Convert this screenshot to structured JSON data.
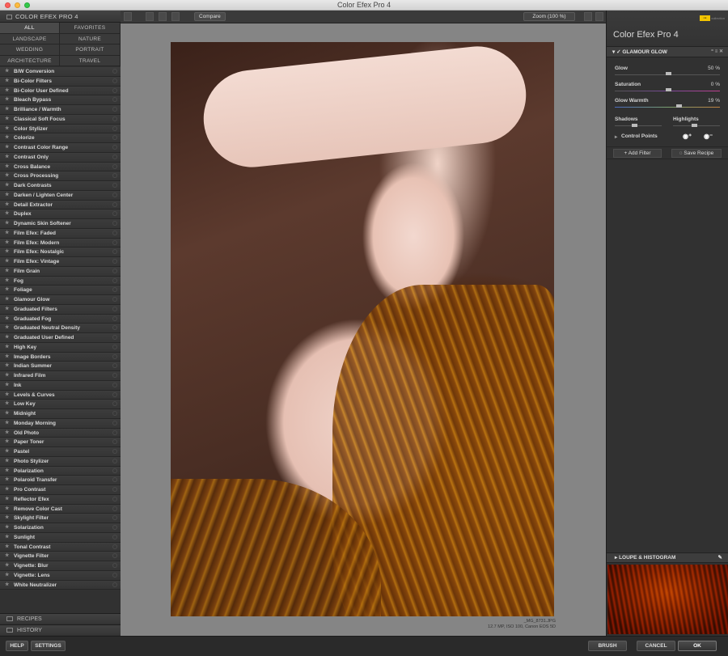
{
  "window": {
    "title": "Color Efex Pro 4"
  },
  "left_panel": {
    "header": "COLOR EFEX PRO 4",
    "categories": [
      "ALL",
      "FAVORITES",
      "LANDSCAPE",
      "NATURE",
      "WEDDING",
      "PORTRAIT",
      "ARCHITECTURE",
      "TRAVEL"
    ],
    "active_category": "ALL",
    "filters": [
      "B/W Conversion",
      "Bi-Color Filters",
      "Bi-Color User Defined",
      "Bleach Bypass",
      "Brilliance / Warmth",
      "Classical Soft Focus",
      "Color Stylizer",
      "Colorize",
      "Contrast Color Range",
      "Contrast Only",
      "Cross Balance",
      "Cross Processing",
      "Dark Contrasts",
      "Darken / Lighten Center",
      "Detail Extractor",
      "Duplex",
      "Dynamic Skin Softener",
      "Film Efex: Faded",
      "Film Efex: Modern",
      "Film Efex: Nostalgic",
      "Film Efex: Vintage",
      "Film Grain",
      "Fog",
      "Foliage",
      "Glamour Glow",
      "Graduated Filters",
      "Graduated Fog",
      "Graduated Neutral Density",
      "Graduated User Defined",
      "High Key",
      "Image Borders",
      "Indian Summer",
      "Infrared Film",
      "Ink",
      "Levels & Curves",
      "Low Key",
      "Midnight",
      "Monday Morning",
      "Old Photo",
      "Paper Toner",
      "Pastel",
      "Photo Stylizer",
      "Polarization",
      "Polaroid Transfer",
      "Pro Contrast",
      "Reflector Efex",
      "Remove Color Cast",
      "Skylight Filter",
      "Solarization",
      "Sunlight",
      "Tonal Contrast",
      "Vignette Filter",
      "Vignette: Blur",
      "Vignette: Lens",
      "White Neutralizer"
    ],
    "recipes_label": "RECIPES",
    "history_label": "HISTORY"
  },
  "toolbar": {
    "compare_label": "Compare",
    "zoom_label": "Zoom (100 %)"
  },
  "image": {
    "filename": "_MG_8731.JPG",
    "info": "12.7 MP, ISO 100, Canon EOS 5D"
  },
  "right_panel": {
    "logo_text": "nik",
    "logo_sub": "collection",
    "app_title": "Color Efex Pro",
    "app_version": "4",
    "filter_name": "GLAMOUR GLOW",
    "sliders": [
      {
        "label": "Glow",
        "value": "50 %",
        "level": 0.5
      },
      {
        "label": "Saturation",
        "value": "0 %",
        "level": 0.5
      },
      {
        "label": "Glow Warmth",
        "value": "19 %",
        "level": 0.6
      }
    ],
    "shadows_label": "Shadows",
    "highlights_label": "Highlights",
    "control_points_label": "Control Points",
    "add_filter_label": "Add Filter",
    "save_recipe_label": "Save Recipe",
    "loupe_label": "LOUPE & HISTOGRAM"
  },
  "bottom": {
    "help": "HELP",
    "settings": "SETTINGS",
    "brush": "BRUSH",
    "cancel": "CANCEL",
    "ok": "OK"
  }
}
